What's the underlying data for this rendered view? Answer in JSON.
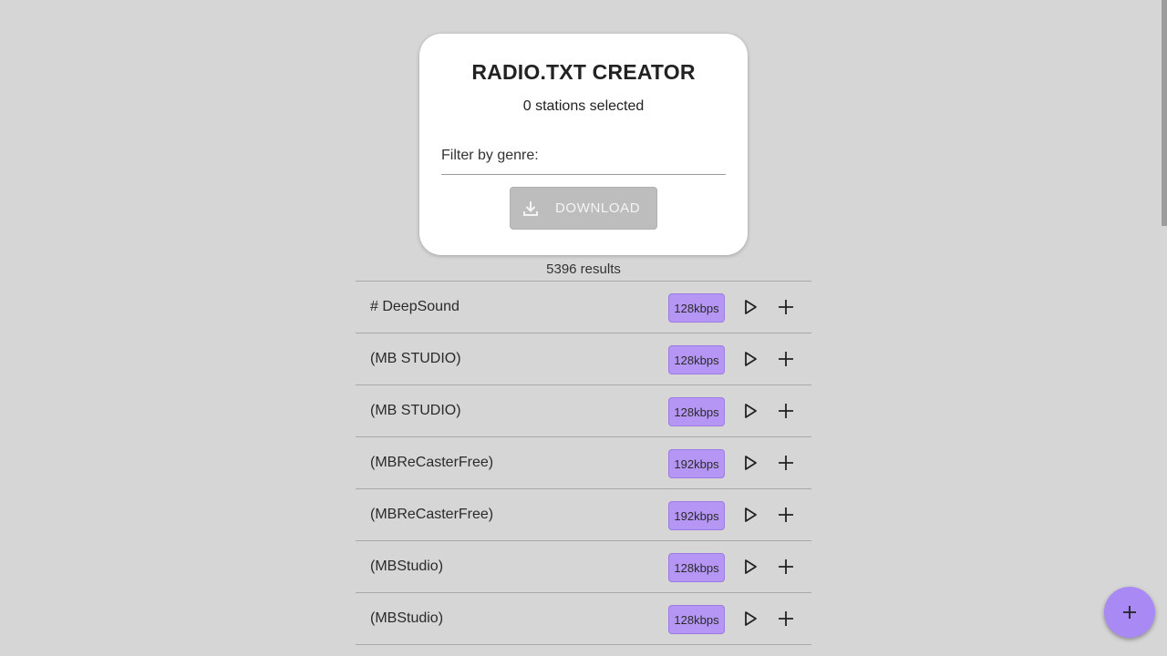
{
  "card": {
    "title": "RADIO.TXT CREATOR",
    "selected_count": "0 stations selected",
    "filter_label": "Filter by genre:",
    "filter_value": "",
    "download_label": "DOWNLOAD",
    "download_icon": "download-icon"
  },
  "results": {
    "count_text": "5396 results"
  },
  "stations": [
    {
      "name": "# DeepSound",
      "bitrate": "128kbps"
    },
    {
      "name": "(MB STUDIO)",
      "bitrate": "128kbps"
    },
    {
      "name": "(MB STUDIO)",
      "bitrate": "128kbps"
    },
    {
      "name": "(MBReCasterFree)",
      "bitrate": "192kbps"
    },
    {
      "name": "(MBReCasterFree)",
      "bitrate": "192kbps"
    },
    {
      "name": "(MBStudio)",
      "bitrate": "128kbps"
    },
    {
      "name": "(MBStudio)",
      "bitrate": "128kbps"
    }
  ],
  "row_icons": {
    "play": "play-icon",
    "add": "plus-icon"
  },
  "fab": {
    "icon": "plus-icon"
  },
  "colors": {
    "background": "#d6d6d6",
    "card": "#ffffff",
    "bitrate_badge": "#b596f5",
    "fab": "#a98af5",
    "download_disabled": "#bdbdbd"
  }
}
